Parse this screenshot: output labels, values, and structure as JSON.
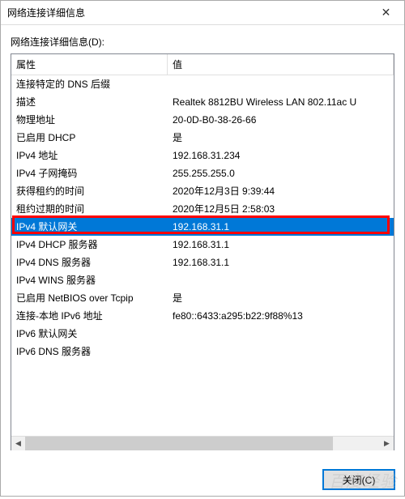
{
  "window": {
    "title": "网络连接详细信息",
    "close_symbol": "✕"
  },
  "label": "网络连接详细信息(D):",
  "columns": {
    "property": "属性",
    "value": "值"
  },
  "rows": [
    {
      "prop": "连接特定的 DNS 后缀",
      "val": ""
    },
    {
      "prop": "描述",
      "val": "Realtek 8812BU Wireless LAN 802.11ac U"
    },
    {
      "prop": "物理地址",
      "val": "20-0D-B0-38-26-66"
    },
    {
      "prop": "已启用 DHCP",
      "val": "是"
    },
    {
      "prop": "IPv4 地址",
      "val": "192.168.31.234"
    },
    {
      "prop": "IPv4 子网掩码",
      "val": "255.255.255.0"
    },
    {
      "prop": "获得租约的时间",
      "val": "2020年12月3日 9:39:44"
    },
    {
      "prop": "租约过期的时间",
      "val": "2020年12月5日 2:58:03"
    },
    {
      "prop": "IPv4 默认网关",
      "val": "192.168.31.1",
      "selected": true
    },
    {
      "prop": "IPv4 DHCP 服务器",
      "val": "192.168.31.1"
    },
    {
      "prop": "IPv4 DNS 服务器",
      "val": "192.168.31.1"
    },
    {
      "prop": "IPv4 WINS 服务器",
      "val": ""
    },
    {
      "prop": "已启用 NetBIOS over Tcpip",
      "val": "是"
    },
    {
      "prop": "连接-本地 IPv6 地址",
      "val": "fe80::6433:a295:b22:9f88%13"
    },
    {
      "prop": "IPv6 默认网关",
      "val": ""
    },
    {
      "prop": "IPv6 DNS 服务器",
      "val": ""
    }
  ],
  "buttons": {
    "close": "关闭(C)"
  },
  "scroll": {
    "left": "◀",
    "right": "▶"
  },
  "watermark": "百度经验"
}
